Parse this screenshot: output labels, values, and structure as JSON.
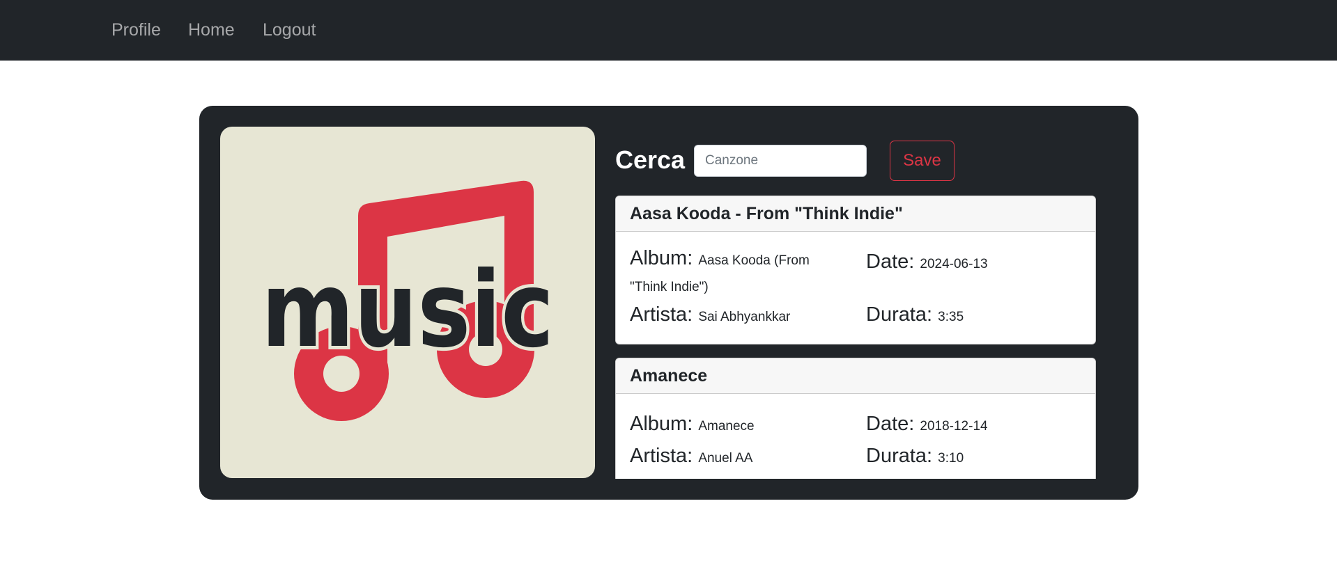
{
  "nav": {
    "items": [
      "Profile",
      "Home",
      "Logout"
    ]
  },
  "artwork": {
    "text": "music",
    "icon": "music-note-icon"
  },
  "search": {
    "label": "Cerca",
    "placeholder": "Canzone",
    "value": ""
  },
  "save_button": "Save",
  "labels": {
    "album": "Album:",
    "date": "Date:",
    "artist": "Artista:",
    "duration": "Durata:"
  },
  "results": [
    {
      "title": "Aasa Kooda - From \"Think Indie\"",
      "album": "Aasa Kooda (From \"Think Indie\")",
      "date": "2024-06-13",
      "artist": "Sai Abhyankkar",
      "duration": "3:35"
    },
    {
      "title": "Amanece",
      "album": "Amanece",
      "date": "2018-12-14",
      "artist": "Anuel AA",
      "duration": "3:10"
    }
  ],
  "colors": {
    "navbar": "#212529",
    "panel": "#212529",
    "accent": "#dc3545",
    "art_bg": "#e7e6d4",
    "note": "#dc3545"
  }
}
